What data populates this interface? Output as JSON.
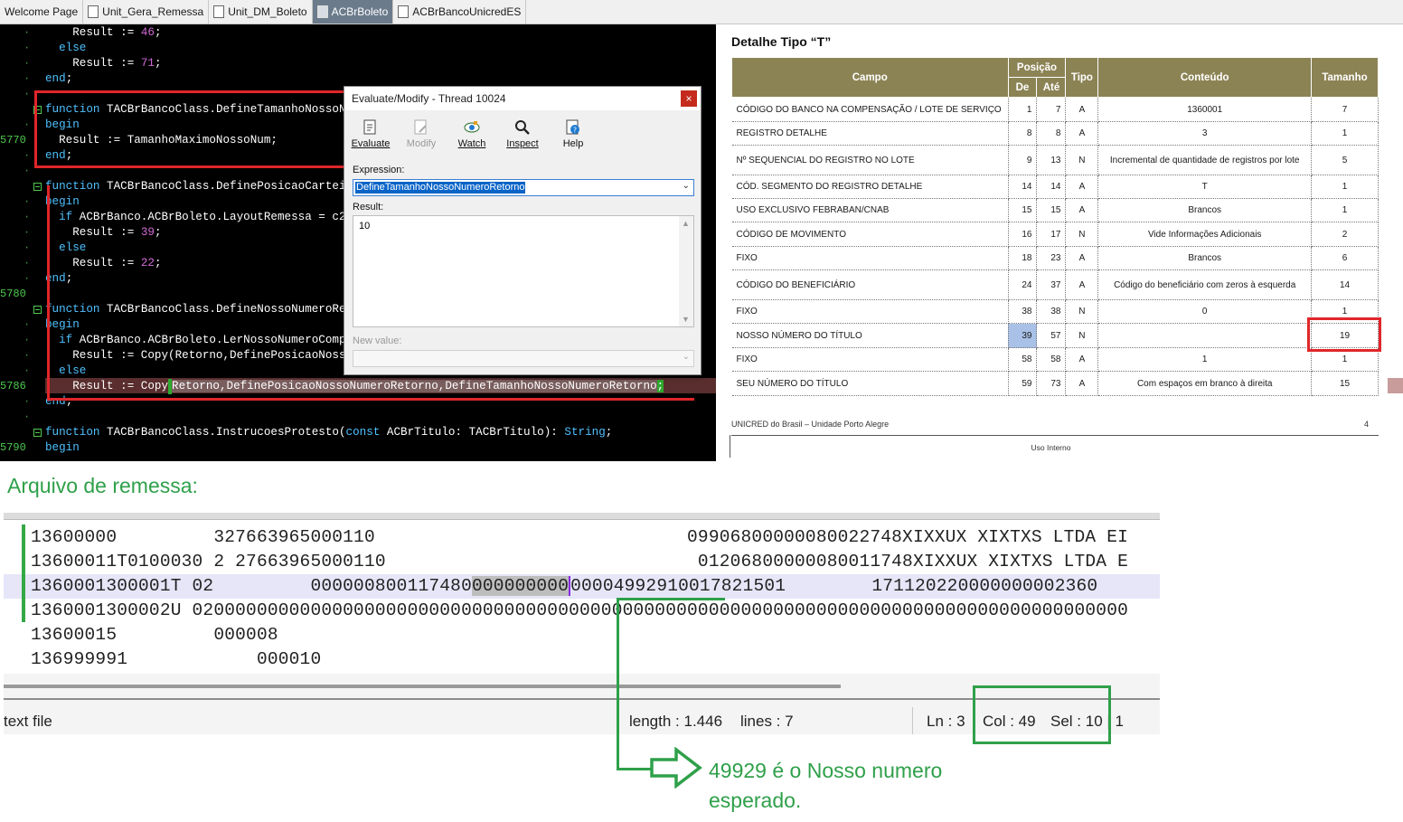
{
  "tabs": [
    {
      "label": "Welcome Page",
      "icon": "none"
    },
    {
      "label": "Unit_Gera_Remessa",
      "icon": "unit-file-icon"
    },
    {
      "label": "Unit_DM_Boleto",
      "icon": "unit-file-icon"
    },
    {
      "label": "ACBrBoleto",
      "icon": "unit-file-icon",
      "active": true
    },
    {
      "label": "ACBrBancoUnicredES",
      "icon": "unit-file-icon"
    }
  ],
  "editor": {
    "lines": [
      {
        "ln": "",
        "code": "    Result := ",
        "num": "46",
        "tail": ";"
      },
      {
        "ln": "",
        "kw": "  else"
      },
      {
        "ln": "",
        "code": "    Result := ",
        "num": "71",
        "tail": ";"
      },
      {
        "ln": "",
        "kw": "end",
        "tail": ";"
      },
      {
        "ln": "",
        "code": ""
      },
      {
        "ln": "",
        "kw": "function",
        "code": " TACBrBancoClass.DefineTamanhoNossoNumeroRetorno: Integer;"
      },
      {
        "ln": "",
        "kw": "begin"
      },
      {
        "ln": "5770",
        "code": "  Result := TamanhoMaximoNossoNum;"
      },
      {
        "ln": "",
        "kw": "end",
        "tail": ";"
      },
      {
        "ln": "",
        "code": ""
      },
      {
        "ln": "",
        "kw": "function",
        "code": " TACBrBancoClass.DefinePosicaoCarteiraRetorno: Integer;"
      },
      {
        "ln": "",
        "kw": "begin"
      },
      {
        "ln": "",
        "kw": "  if",
        "code": " ACBrBanco.ACBrBoleto.LayoutRemessa = c240 then"
      },
      {
        "ln": "",
        "code": "    Result := ",
        "num": "39",
        "tail": ";"
      },
      {
        "ln": "",
        "kw": "  else"
      },
      {
        "ln": "",
        "code": "    Result := ",
        "num": "22",
        "tail": ";"
      },
      {
        "ln": "",
        "kw": "end",
        "tail": ";"
      },
      {
        "ln": "5780",
        "code": ""
      },
      {
        "ln": "",
        "kw": "function",
        "code": " TACBrBancoClass.DefineNossoNumeroRetorno(const Retorno: String): String;"
      },
      {
        "ln": "",
        "kw": "begin"
      },
      {
        "ln": "",
        "kw": "  if",
        "code": " ACBrBanco.ACBrBoleto.LerNossoNumeroCompleto then"
      },
      {
        "ln": "",
        "code": "    Result := Copy(Retorno,DefinePosicaoNossoNumeroRetorno,TamanhoMaximoNossoNum)"
      },
      {
        "ln": "",
        "kw": "  else"
      },
      {
        "ln": "5786",
        "code": "",
        "special": "current"
      },
      {
        "ln": "",
        "kw": "end",
        "tail": ";"
      },
      {
        "ln": "",
        "code": ""
      },
      {
        "ln": "",
        "kw": "function",
        "code": " TACBrBancoClass.InstrucoesProtesto(",
        "kw2": "const",
        "code2": " ACBrTitulo: TACBrTitulo): ",
        "kw3": "String",
        "tail": ";"
      },
      {
        "ln": "5790",
        "kw": "begin"
      }
    ],
    "current_line": {
      "prefix": "    Result := Copy",
      "arg1": "Retorno,",
      "arg2": "DefinePosicaoNossoNumeroRetorno,",
      "arg3": "DefineTamanhoNossoNumeroRetorno",
      "suffix": ";"
    }
  },
  "dialog": {
    "title": "Evaluate/Modify - Thread 10024",
    "close": "×",
    "tools": [
      {
        "label": "Evaluate",
        "icon": "evaluate-icon",
        "enabled": true
      },
      {
        "label": "Modify",
        "icon": "modify-icon",
        "enabled": false
      },
      {
        "label": "Watch",
        "icon": "watch-icon",
        "enabled": true
      },
      {
        "label": "Inspect",
        "icon": "inspect-icon",
        "enabled": true
      },
      {
        "label": "Help",
        "icon": "help-icon",
        "enabled": true
      }
    ],
    "expression_label": "Expression:",
    "expression_value": "DefineTamanhoNossoNumeroRetorno",
    "result_label": "Result:",
    "result_value": "10",
    "newvalue_label": "New value:"
  },
  "doc": {
    "title": "Detalhe Tipo “T”",
    "headers": {
      "campo": "Campo",
      "posicao": "Posição",
      "de": "De",
      "ate": "Até",
      "tipo": "Tipo",
      "conteudo": "Conteúdo",
      "tamanho": "Tamanho"
    },
    "rows": [
      {
        "campo": "CÓDIGO DO BANCO NA COMPENSAÇÃO / LOTE DE SERVIÇO",
        "de": "1",
        "ate": "7",
        "tipo": "A",
        "conteudo": "1360001",
        "tamanho": "7"
      },
      {
        "campo": "REGISTRO DETALHE",
        "de": "8",
        "ate": "8",
        "tipo": "A",
        "conteudo": "3",
        "tamanho": "1"
      },
      {
        "campo": "Nº SEQUENCIAL DO REGISTRO NO LOTE",
        "de": "9",
        "ate": "13",
        "tipo": "N",
        "conteudo": "Incremental de quantidade de registros por lote",
        "tamanho": "5"
      },
      {
        "campo": "CÓD. SEGMENTO DO REGISTRO DETALHE",
        "de": "14",
        "ate": "14",
        "tipo": "A",
        "conteudo": "T",
        "tamanho": "1"
      },
      {
        "campo": "USO EXCLUSIVO FEBRABAN/CNAB",
        "de": "15",
        "ate": "15",
        "tipo": "A",
        "conteudo": "Brancos",
        "tamanho": "1"
      },
      {
        "campo": "CÓDIGO DE MOVIMENTO",
        "de": "16",
        "ate": "17",
        "tipo": "N",
        "conteudo": "Vide Informações Adicionais",
        "tamanho": "2"
      },
      {
        "campo": "FIXO",
        "de": "18",
        "ate": "23",
        "tipo": "A",
        "conteudo": "Brancos",
        "tamanho": "6"
      },
      {
        "campo": "CÓDIGO DO BENEFICIÁRIO",
        "de": "24",
        "ate": "37",
        "tipo": "A",
        "conteudo": "Código do beneficiário com zeros à esquerda",
        "tamanho": "14"
      },
      {
        "campo": "FIXO",
        "de": "38",
        "ate": "38",
        "tipo": "N",
        "conteudo": "0",
        "tamanho": "1"
      },
      {
        "campo": "NOSSO NÚMERO DO TÍTULO",
        "de": "39",
        "ate": "57",
        "tipo": "N",
        "conteudo": "",
        "tamanho": "19"
      },
      {
        "campo": "FIXO",
        "de": "58",
        "ate": "58",
        "tipo": "A",
        "conteudo": "1",
        "tamanho": "1"
      },
      {
        "campo": "SEU NÚMERO DO TÍTULO",
        "de": "59",
        "ate": "73",
        "tipo": "A",
        "conteudo": "Com espaços em branco à direita",
        "tamanho": "15"
      }
    ],
    "footer": "UNICRED do Brasil – Unidade Porto Alegre",
    "page": "4",
    "internal": "Uso Interno"
  },
  "heading": "Arquivo de remessa:",
  "file": {
    "lines": [
      "13600000         327663965000110                             09906800000080022748XIXXUX XIXTXS LTDA EI",
      "13600011T0100030 2 27663965000110                             01206800000080011748XIXXUX XIXTXS LTDA E",
      "",
      "1360001300002U 020000000000000000000000000000000000000000000000000000000000000000000000000000000000000",
      "13600015         000008",
      "136999991            000010"
    ],
    "current": {
      "prefix": "1360001300001T 02         000000800117480",
      "selected": "000000000",
      "after": "00004992910017821501        171120220000000002360"
    }
  },
  "status": {
    "file_type": "text file",
    "length": "length : 1.446",
    "lines": "lines : 7",
    "ln": "Ln : 3",
    "col": "Col : 49",
    "sel": "Sel : 10 | 1"
  },
  "note": {
    "line1": "49929 é o Nosso numero",
    "line2": "esperado."
  },
  "colors": {
    "annotation_green": "#2fa04a",
    "annotation_red": "#e0262a",
    "table_header": "#8c8355"
  }
}
